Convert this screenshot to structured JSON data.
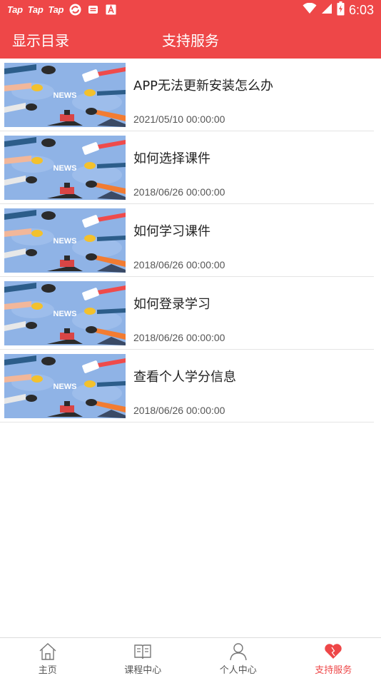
{
  "status_bar": {
    "apps": [
      "Tap",
      "Tap",
      "Tap"
    ],
    "icons": [
      "sync-icon",
      "message-icon",
      "font-icon"
    ],
    "time": "6:03"
  },
  "header": {
    "left_label": "显示目录",
    "title": "支持服务"
  },
  "thumbnail_text": "NEWS",
  "articles": [
    {
      "title": "APP无法更新安装怎么办",
      "date": "2021/05/10  00:00:00"
    },
    {
      "title": "如何选择课件",
      "date": "2018/06/26  00:00:00"
    },
    {
      "title": "如何学习课件",
      "date": "2018/06/26  00:00:00"
    },
    {
      "title": "如何登录学习",
      "date": "2018/06/26  00:00:00"
    },
    {
      "title": "查看个人学分信息",
      "date": "2018/06/26  00:00:00"
    }
  ],
  "bottom_nav": [
    {
      "label": "主页",
      "icon": "home-icon",
      "active": false
    },
    {
      "label": "课程中心",
      "icon": "book-icon",
      "active": false
    },
    {
      "label": "个人中心",
      "icon": "person-icon",
      "active": false
    },
    {
      "label": "支持服务",
      "icon": "heart-icon",
      "active": true
    }
  ],
  "colors": {
    "accent": "#ee4748",
    "thumb_bg": "#8fb3e6"
  }
}
